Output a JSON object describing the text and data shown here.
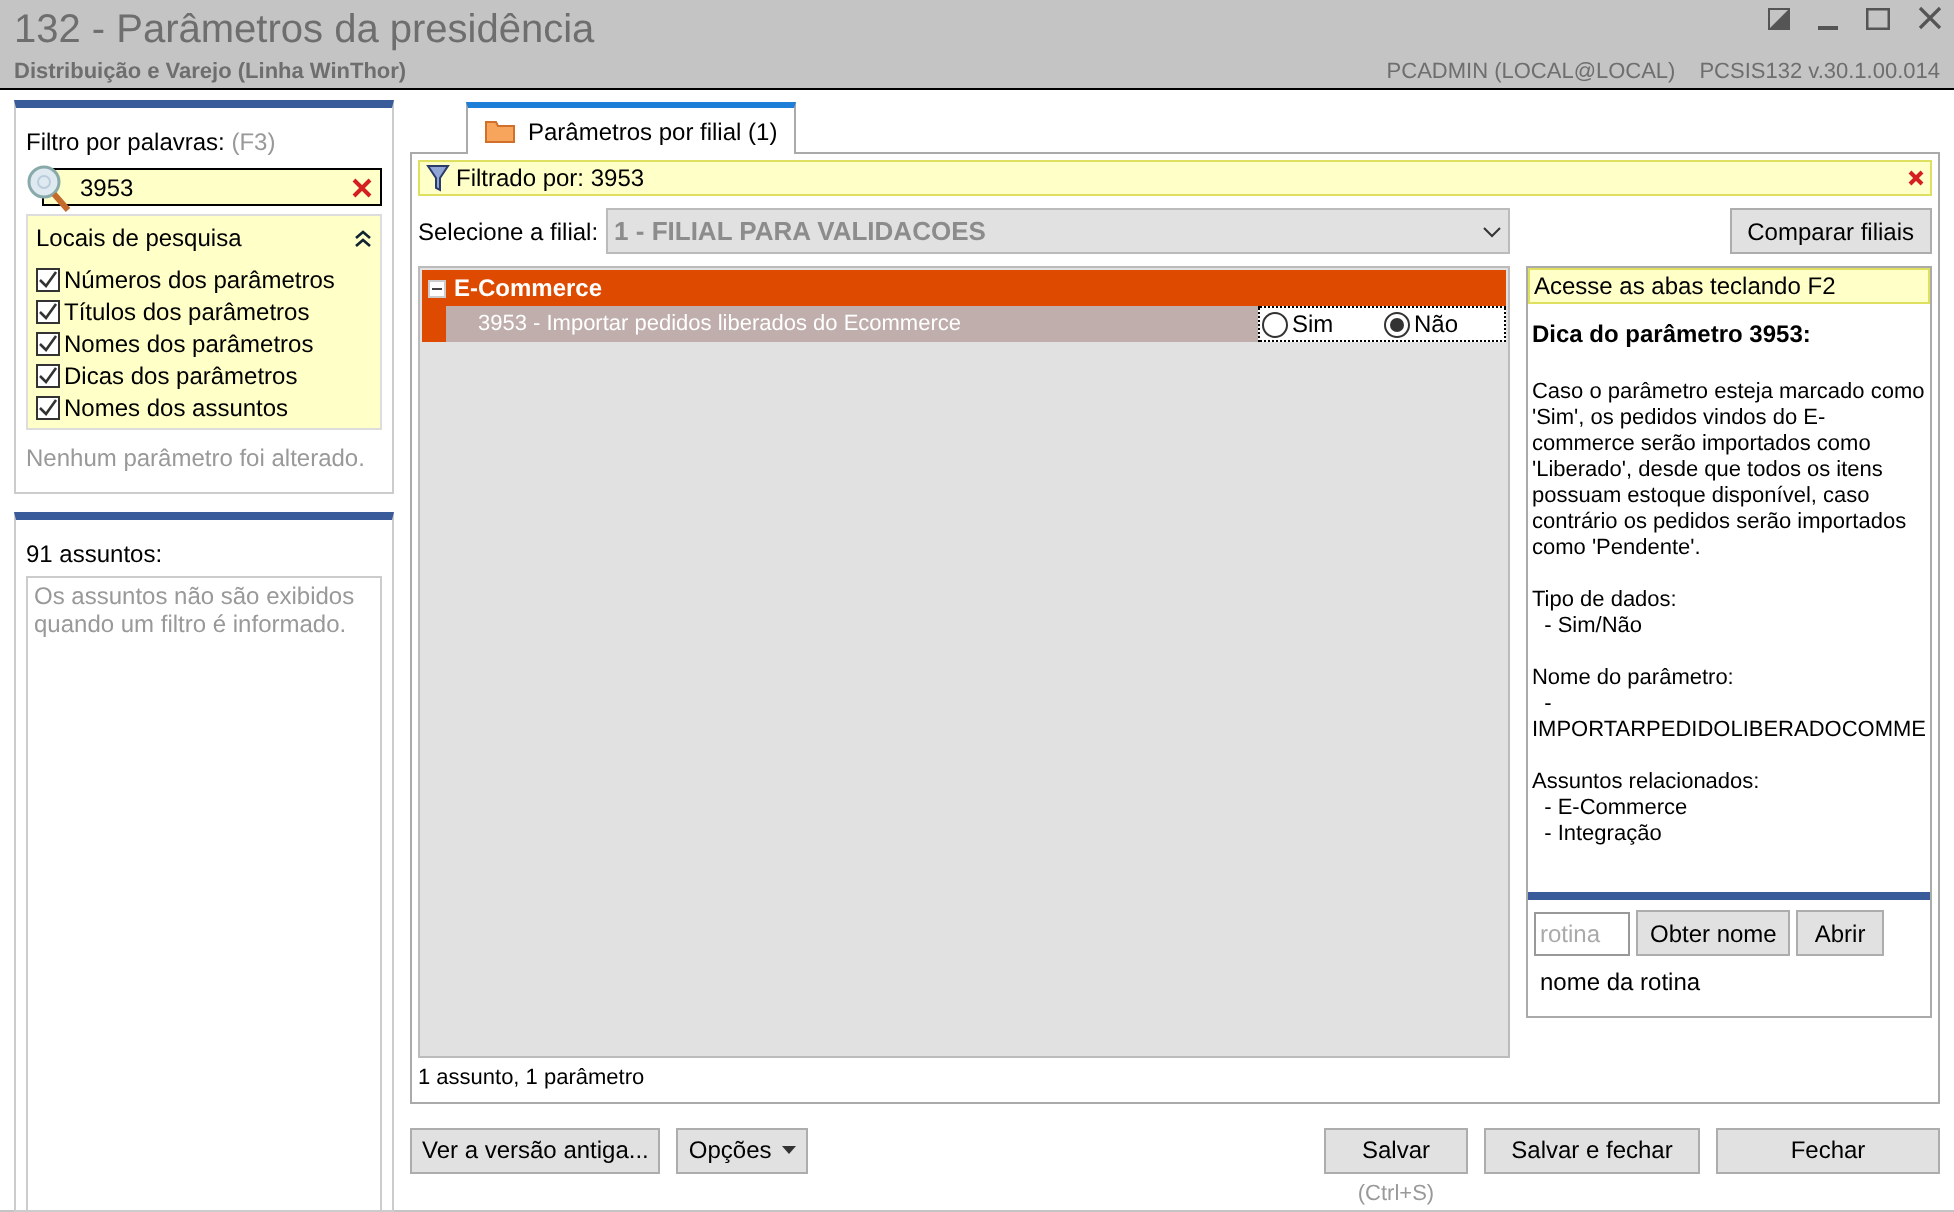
{
  "window": {
    "title": "132 - Parâmetros da presidência",
    "subtitle": "Distribuição e Varejo (Linha WinThor)",
    "user": "PCADMIN (LOCAL@LOCAL)",
    "version": "PCSIS132  v.30.1.00.014"
  },
  "filter": {
    "label": "Filtro por palavras:",
    "shortcut": "(F3)",
    "value": "3953",
    "search_places": {
      "title": "Locais de pesquisa",
      "expanded": true,
      "options": [
        {
          "label": "Números dos parâmetros",
          "checked": true
        },
        {
          "label": "Títulos dos parâmetros",
          "checked": true
        },
        {
          "label": "Nomes dos parâmetros",
          "checked": true
        },
        {
          "label": "Dicas dos parâmetros",
          "checked": true
        },
        {
          "label": "Nomes dos assuntos",
          "checked": true
        }
      ]
    },
    "status": "Nenhum parâmetro foi alterado."
  },
  "subjects": {
    "count": "91 assuntos:",
    "note": "Os assuntos não são exibidos quando um filtro é informado."
  },
  "tabs": [
    {
      "label": "Parâmetros por filial  (1)",
      "selected": true
    }
  ],
  "filter_bar": "Filtrado por: 3953",
  "branch": {
    "label": "Selecione a filial:",
    "value": "1 - FILIAL PARA VALIDACOES",
    "button": "Comparar filiais"
  },
  "groups": [
    {
      "title": "E-Commerce",
      "expanded": true,
      "params": [
        {
          "label": "3953 - Importar pedidos liberados do Ecommerce",
          "options": [
            {
              "label": "Sim",
              "selected": false
            },
            {
              "label": "Não",
              "selected": true
            }
          ]
        }
      ]
    }
  ],
  "summary": "1 assunto, 1 parâmetro",
  "hint": {
    "banner": "Acesse as abas teclando F2",
    "title": "Dica do parâmetro 3953:",
    "paragraphs": [
      "Caso o parâmetro esteja marcado como 'Sim', os pedidos vindos do E-commerce serão importados como 'Liberado', desde que todos os itens possuam estoque disponível, caso contrário os pedidos serão importados como 'Pendente'.",
      "Tipo de dados:\n  - Sim/Não",
      "Nome do parâmetro:\n  -\nIMPORTARPEDIDOLIBERADOCOMME",
      "Assuntos relacionados:\n  - E-Commerce\n  - Integração"
    ]
  },
  "routine": {
    "placeholder": "rotina",
    "buttons": [
      "Obter nome",
      "Abrir"
    ],
    "name": "nome da rotina"
  },
  "footer": {
    "left_buttons": [
      {
        "label": "Ver a versão antiga...",
        "kind": "plain"
      },
      {
        "label": "Opções",
        "kind": "menu"
      }
    ],
    "right_buttons": [
      {
        "label": "Salvar"
      },
      {
        "label": "Salvar e fechar"
      },
      {
        "label": "Fechar"
      }
    ],
    "save_shortcut": "(Ctrl+S)"
  }
}
